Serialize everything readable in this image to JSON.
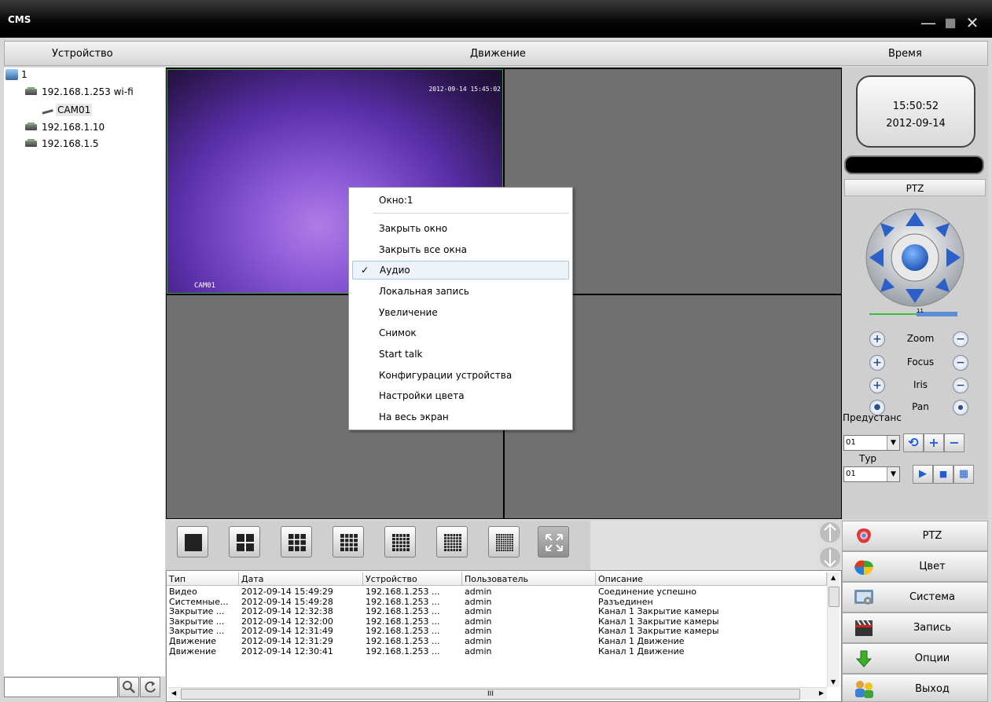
{
  "window": {
    "title": "CMS",
    "minimize_glyph": "—",
    "maximize_glyph": "■",
    "close_glyph": "✕"
  },
  "columns": {
    "device": "Устройство",
    "motion": "Движение",
    "time": "Время"
  },
  "tree": {
    "root": "1",
    "items": [
      {
        "label": "192.168.1.253 wi-fi",
        "icon": "device-icon"
      },
      {
        "label": "CAM01",
        "icon": "camera-icon"
      },
      {
        "label": "192.168.1.10",
        "icon": "device-icon"
      },
      {
        "label": "192.168.1.5",
        "icon": "device-icon"
      }
    ]
  },
  "video": {
    "osd_time": "2012-09-14 15:45:02",
    "osd_name": "CAM01"
  },
  "context_menu": {
    "header": "Окно:1",
    "check_glyph": "✓",
    "items": [
      "Закрыть окно",
      "Закрыть все окна",
      "Аудио",
      "Локальная запись",
      "Увеличение",
      "Снимок",
      "Start talk",
      "Конфигурации устройства",
      "Настройки цвета",
      "На весь экран"
    ]
  },
  "clock": {
    "time": "15:50:52",
    "date": "2012-09-14"
  },
  "ptz": {
    "header": "PTZ",
    "zoom": "Zoom",
    "focus": "Focus",
    "iris": "Iris",
    "pan": "Pan",
    "preset_label": "Предустанс",
    "preset_value": "01",
    "tour_label": "Тур",
    "tour_value": "01",
    "slider_value": "11"
  },
  "log": {
    "headers": [
      "Тип",
      "Дата",
      "Устройство",
      "Пользователь",
      "Описание"
    ],
    "rows": [
      [
        "Видео",
        "2012-09-14 15:49:29",
        "192.168.1.253 ...",
        "admin",
        "Соединение успешно"
      ],
      [
        "Системные...",
        "2012-09-14 15:49:28",
        "192.168.1.253 ...",
        "admin",
        "Разъединен"
      ],
      [
        "Закрытие ...",
        "2012-09-14 12:32:38",
        "192.168.1.253 ...",
        "admin",
        "Канал 1 Закрытие камеры"
      ],
      [
        "Закрытие ...",
        "2012-09-14 12:32:00",
        "192.168.1.253 ...",
        "admin",
        "Канал 1 Закрытие камеры"
      ],
      [
        "Закрытие ...",
        "2012-09-14 12:31:49",
        "192.168.1.253 ...",
        "admin",
        "Канал 1 Закрытие камеры"
      ],
      [
        "Движение",
        "2012-09-14 12:31:29",
        "192.168.1.253 ...",
        "admin",
        "Канал 1 Движение"
      ],
      [
        "Движение",
        "2012-09-14 12:30:41",
        "192.168.1.253 ...",
        "admin",
        "Канал 1 Движение"
      ]
    ],
    "hscroll_grip": "III"
  },
  "nav": [
    {
      "label": "PTZ",
      "icon": "ptz-icon"
    },
    {
      "label": "Цвет",
      "icon": "color-icon"
    },
    {
      "label": "Система",
      "icon": "system-icon"
    },
    {
      "label": "Запись",
      "icon": "record-icon"
    },
    {
      "label": "Опции",
      "icon": "options-icon"
    },
    {
      "label": "Выход",
      "icon": "exit-icon"
    }
  ],
  "colors": {
    "accent": "#2b5fd0",
    "selection_border": "#3ea03e",
    "titlebar": "#000000"
  }
}
